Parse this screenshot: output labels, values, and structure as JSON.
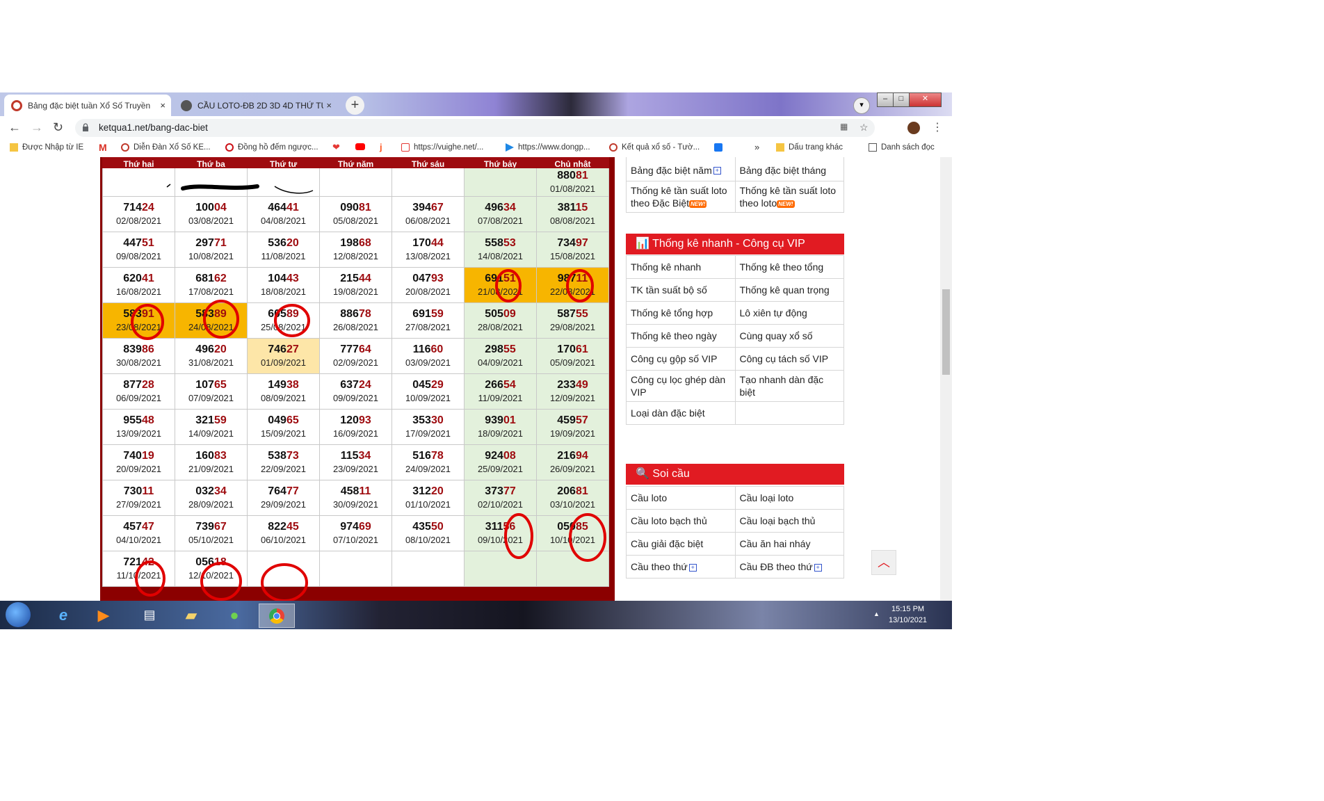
{
  "tabs": [
    {
      "title": "Bảng đặc biệt tuần Xổ Số Truyền",
      "close": "×",
      "favicon_color": "#c0392b"
    },
    {
      "title": "CẦU LOTO-ĐB 2D 3D 4D THỨ TƯ",
      "close": "×",
      "favicon_color": "#555555"
    }
  ],
  "new_tab": "+",
  "window_buttons": {
    "minimize": "–",
    "maximize": "□",
    "close": "✕"
  },
  "address": {
    "url": "ketqua1.net/bang-dac-biet"
  },
  "bookmarks": [
    {
      "label": "Được Nhập từ IE",
      "icon": "folder-icon",
      "color": "#f5c542"
    },
    {
      "label": "",
      "icon": "gmail-icon",
      "color": "#d93025"
    },
    {
      "label": "Diễn Đàn Xổ Số KE...",
      "icon": "xoso-icon",
      "color": "#c0392b"
    },
    {
      "label": "Đồng hồ đếm ngược...",
      "icon": "opera-icon",
      "color": "#cc0f16"
    },
    {
      "label": "",
      "icon": "heart-icon",
      "color": "#e53935"
    },
    {
      "label": "",
      "icon": "youtube-icon",
      "color": "#ff0000"
    },
    {
      "label": "",
      "icon": "j-icon",
      "color": "#ff5722"
    },
    {
      "label": "https://vuighe.net/...",
      "icon": "play-icon",
      "color": "#e53935"
    },
    {
      "label": "https://www.dongp...",
      "icon": "arrow-icon",
      "color": "#1e88e5"
    },
    {
      "label": "Kết quả xổ số - Tườ...",
      "icon": "xoso-icon",
      "color": "#c0392b"
    },
    {
      "label": "",
      "icon": "facebook-icon",
      "color": "#1877f2"
    }
  ],
  "bookmarks_more": "»",
  "bookmarks_other": "Dấu trang khác",
  "reading_list": "Danh sách đọc",
  "table_header": [
    "Thứ hai",
    "Thứ ba",
    "Thứ tư",
    "Thứ năm",
    "Thứ sáu",
    "Thứ bảy",
    "Chủ nhật"
  ],
  "table_rows": [
    [
      {
        "head": "",
        "tail": "",
        "date": ""
      },
      {
        "head": "",
        "tail": "",
        "date": ""
      },
      {
        "head": "",
        "tail": "",
        "date": ""
      },
      {
        "head": "",
        "tail": "",
        "date": ""
      },
      {
        "head": "",
        "tail": "",
        "date": ""
      },
      {
        "head": "",
        "tail": "",
        "date": ""
      },
      {
        "head": "880",
        "tail": "81",
        "date": "01/08/2021"
      }
    ],
    [
      {
        "head": "714",
        "tail": "24",
        "date": "02/08/2021"
      },
      {
        "head": "100",
        "tail": "04",
        "date": "03/08/2021"
      },
      {
        "head": "464",
        "tail": "41",
        "date": "04/08/2021"
      },
      {
        "head": "090",
        "tail": "81",
        "date": "05/08/2021"
      },
      {
        "head": "394",
        "tail": "67",
        "date": "06/08/2021"
      },
      {
        "head": "496",
        "tail": "34",
        "date": "07/08/2021"
      },
      {
        "head": "381",
        "tail": "15",
        "date": "08/08/2021"
      }
    ],
    [
      {
        "head": "447",
        "tail": "51",
        "date": "09/08/2021"
      },
      {
        "head": "297",
        "tail": "71",
        "date": "10/08/2021"
      },
      {
        "head": "536",
        "tail": "20",
        "date": "11/08/2021"
      },
      {
        "head": "198",
        "tail": "68",
        "date": "12/08/2021"
      },
      {
        "head": "170",
        "tail": "44",
        "date": "13/08/2021"
      },
      {
        "head": "558",
        "tail": "53",
        "date": "14/08/2021"
      },
      {
        "head": "734",
        "tail": "97",
        "date": "15/08/2021"
      }
    ],
    [
      {
        "head": "620",
        "tail": "41",
        "date": "16/08/2021"
      },
      {
        "head": "681",
        "tail": "62",
        "date": "17/08/2021"
      },
      {
        "head": "104",
        "tail": "43",
        "date": "18/08/2021"
      },
      {
        "head": "215",
        "tail": "44",
        "date": "19/08/2021"
      },
      {
        "head": "047",
        "tail": "93",
        "date": "20/08/2021"
      },
      {
        "head": "691",
        "tail": "51",
        "date": "21/08/2021",
        "hl": "hl"
      },
      {
        "head": "987",
        "tail": "11",
        "date": "22/08/2021",
        "hl": "hl"
      }
    ],
    [
      {
        "head": "583",
        "tail": "91",
        "date": "23/08/2021",
        "hl": "hl"
      },
      {
        "head": "583",
        "tail": "89",
        "date": "24/08/2021",
        "hl": "hl"
      },
      {
        "head": "605",
        "tail": "89",
        "date": "25/08/2021"
      },
      {
        "head": "886",
        "tail": "78",
        "date": "26/08/2021"
      },
      {
        "head": "691",
        "tail": "59",
        "date": "27/08/2021"
      },
      {
        "head": "505",
        "tail": "09",
        "date": "28/08/2021"
      },
      {
        "head": "587",
        "tail": "55",
        "date": "29/08/2021"
      }
    ],
    [
      {
        "head": "839",
        "tail": "86",
        "date": "30/08/2021"
      },
      {
        "head": "496",
        "tail": "20",
        "date": "31/08/2021"
      },
      {
        "head": "746",
        "tail": "27",
        "date": "01/09/2021",
        "hl": "lt"
      },
      {
        "head": "777",
        "tail": "64",
        "date": "02/09/2021"
      },
      {
        "head": "116",
        "tail": "60",
        "date": "03/09/2021"
      },
      {
        "head": "298",
        "tail": "55",
        "date": "04/09/2021"
      },
      {
        "head": "170",
        "tail": "61",
        "date": "05/09/2021"
      }
    ],
    [
      {
        "head": "877",
        "tail": "28",
        "date": "06/09/2021"
      },
      {
        "head": "107",
        "tail": "65",
        "date": "07/09/2021"
      },
      {
        "head": "149",
        "tail": "38",
        "date": "08/09/2021"
      },
      {
        "head": "637",
        "tail": "24",
        "date": "09/09/2021"
      },
      {
        "head": "045",
        "tail": "29",
        "date": "10/09/2021"
      },
      {
        "head": "266",
        "tail": "54",
        "date": "11/09/2021"
      },
      {
        "head": "233",
        "tail": "49",
        "date": "12/09/2021"
      }
    ],
    [
      {
        "head": "955",
        "tail": "48",
        "date": "13/09/2021"
      },
      {
        "head": "321",
        "tail": "59",
        "date": "14/09/2021"
      },
      {
        "head": "049",
        "tail": "65",
        "date": "15/09/2021"
      },
      {
        "head": "120",
        "tail": "93",
        "date": "16/09/2021"
      },
      {
        "head": "353",
        "tail": "30",
        "date": "17/09/2021"
      },
      {
        "head": "939",
        "tail": "01",
        "date": "18/09/2021"
      },
      {
        "head": "459",
        "tail": "57",
        "date": "19/09/2021"
      }
    ],
    [
      {
        "head": "740",
        "tail": "19",
        "date": "20/09/2021"
      },
      {
        "head": "160",
        "tail": "83",
        "date": "21/09/2021"
      },
      {
        "head": "538",
        "tail": "73",
        "date": "22/09/2021"
      },
      {
        "head": "115",
        "tail": "34",
        "date": "23/09/2021"
      },
      {
        "head": "516",
        "tail": "78",
        "date": "24/09/2021"
      },
      {
        "head": "924",
        "tail": "08",
        "date": "25/09/2021"
      },
      {
        "head": "216",
        "tail": "94",
        "date": "26/09/2021"
      }
    ],
    [
      {
        "head": "730",
        "tail": "11",
        "date": "27/09/2021"
      },
      {
        "head": "032",
        "tail": "34",
        "date": "28/09/2021"
      },
      {
        "head": "764",
        "tail": "77",
        "date": "29/09/2021"
      },
      {
        "head": "458",
        "tail": "11",
        "date": "30/09/2021"
      },
      {
        "head": "312",
        "tail": "20",
        "date": "01/10/2021"
      },
      {
        "head": "373",
        "tail": "77",
        "date": "02/10/2021"
      },
      {
        "head": "206",
        "tail": "81",
        "date": "03/10/2021"
      }
    ],
    [
      {
        "head": "457",
        "tail": "47",
        "date": "04/10/2021"
      },
      {
        "head": "739",
        "tail": "67",
        "date": "05/10/2021"
      },
      {
        "head": "822",
        "tail": "45",
        "date": "06/10/2021"
      },
      {
        "head": "974",
        "tail": "69",
        "date": "07/10/2021"
      },
      {
        "head": "435",
        "tail": "50",
        "date": "08/10/2021"
      },
      {
        "head": "311",
        "tail": "56",
        "date": "09/10/2021"
      },
      {
        "head": "050",
        "tail": "85",
        "date": "10/10/2021"
      }
    ],
    [
      {
        "head": "721",
        "tail": "42",
        "date": "11/10/2021"
      },
      {
        "head": "056",
        "tail": "18",
        "date": "12/10/2021"
      },
      {
        "head": "",
        "tail": "",
        "date": ""
      },
      {
        "head": "",
        "tail": "",
        "date": ""
      },
      {
        "head": "",
        "tail": "",
        "date": ""
      },
      {
        "head": "",
        "tail": "",
        "date": ""
      },
      {
        "head": "",
        "tail": "",
        "date": ""
      }
    ]
  ],
  "sidebar": {
    "top_grid": [
      [
        "Bảng đặc biệt năm",
        "Bảng đặc biệt tháng"
      ],
      [
        "Thống kê tần suất loto theo Đặc Biệt",
        "Thống kê tần suất loto theo loto"
      ]
    ],
    "new_badge": "NEW!",
    "section1_title": "Thống kê nhanh - Công cụ VIP",
    "section1_items": [
      [
        "Thống kê nhanh",
        "Thống kê theo tổng"
      ],
      [
        "TK tần suất bộ số",
        "Thống kê quan trọng"
      ],
      [
        "Thống kê tổng hợp",
        "Lô xiên tự động"
      ],
      [
        "Thống kê theo ngày",
        "Cùng quay xổ số"
      ],
      [
        "Công cụ gộp số VIP",
        "Công cụ tách số VIP"
      ],
      [
        "Công cụ lọc ghép dàn VIP",
        "Tạo nhanh dàn đặc biệt"
      ],
      [
        "Loại dàn đặc biệt",
        ""
      ]
    ],
    "section2_title": "Soi cầu",
    "section2_items": [
      [
        "Cầu loto",
        "Cầu loại loto"
      ],
      [
        "Cầu loto bạch thủ",
        "Cầu loại bạch thủ"
      ],
      [
        "Cầu giải đặc biệt",
        "Cầu ăn hai nháy"
      ],
      [
        "Cầu theo thứ",
        "Cầu ĐB theo thứ"
      ]
    ],
    "plus": "⊞"
  },
  "back_to_top": "︿",
  "taskbar": {
    "time": "15:15 PM",
    "date": "13/10/2021",
    "apps": [
      "ie-icon",
      "media-player-icon",
      "calendar-icon",
      "explorer-icon",
      "vuze-icon",
      "chrome-icon"
    ]
  }
}
